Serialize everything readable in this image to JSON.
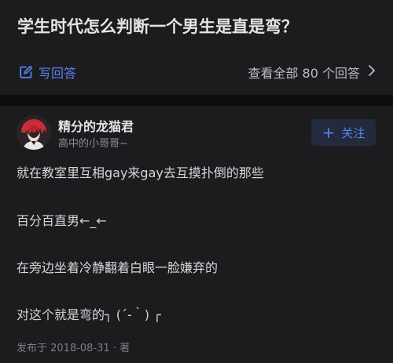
{
  "question": {
    "title": "学生时代怎么判断一个男生是直是弯？",
    "write_answer_label": "写回答",
    "view_all_label": "查看全部 80 个回答"
  },
  "answer": {
    "author": {
      "name": "精分的龙猫君",
      "bio": "高中的小哥哥~"
    },
    "follow_label": "关注",
    "lines": [
      "就在教室里互相gay来gay去互摸扑倒的那些",
      "百分百直男←_←",
      "在旁边坐着冷静翻着白眼一脸嫌弃的",
      "对这个就是弯的┐ (´-｀) ┌"
    ],
    "meta": "发布于 2018-08-31 · 著"
  },
  "colors": {
    "accent": "#5a82ec",
    "card": "#1c1c1f",
    "background": "#0d0d0e"
  }
}
